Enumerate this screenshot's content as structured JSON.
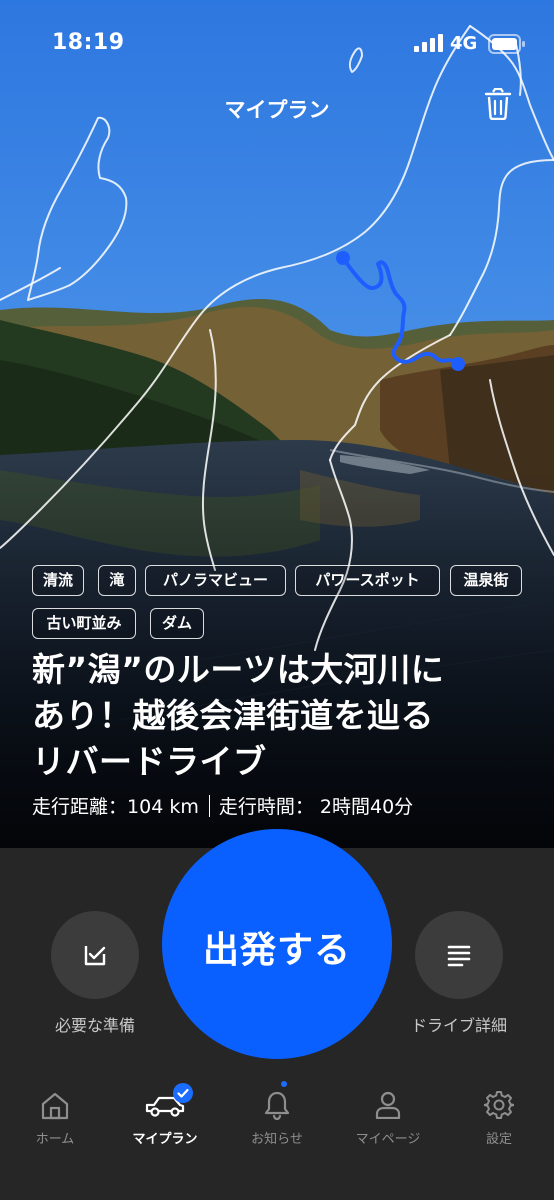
{
  "status_bar": {
    "time": "18:19",
    "network": "4G"
  },
  "header": {
    "title": "マイプラン"
  },
  "plan": {
    "tags": [
      "清流",
      "滝",
      "パノラマビュー",
      "パワースポット",
      "温泉街",
      "古い町並み",
      "ダム"
    ],
    "title_lines": [
      "新”潟”のルーツは大河川に",
      "あり！越後会津街道を辿る",
      "リバードライブ"
    ],
    "distance_label": "走行距離：",
    "distance_value": "104 km",
    "time_label": "走行時間：",
    "time_value": "2時間40分"
  },
  "actions": {
    "prep_label": "必要な準備",
    "start_label": "出発する",
    "details_label": "ドライブ詳細"
  },
  "tabbar": {
    "items": [
      {
        "label": "ホーム",
        "icon": "home-icon"
      },
      {
        "label": "マイプラン",
        "icon": "car-icon"
      },
      {
        "label": "お知らせ",
        "icon": "bell-icon"
      },
      {
        "label": "マイページ",
        "icon": "person-icon"
      },
      {
        "label": "設定",
        "icon": "gear-icon"
      }
    ],
    "active_index": 1
  },
  "colors": {
    "accent": "#0a60ff",
    "route": "#1e5eff",
    "bottom_bg": "#262626",
    "tab_inactive": "#8e8e8e"
  }
}
